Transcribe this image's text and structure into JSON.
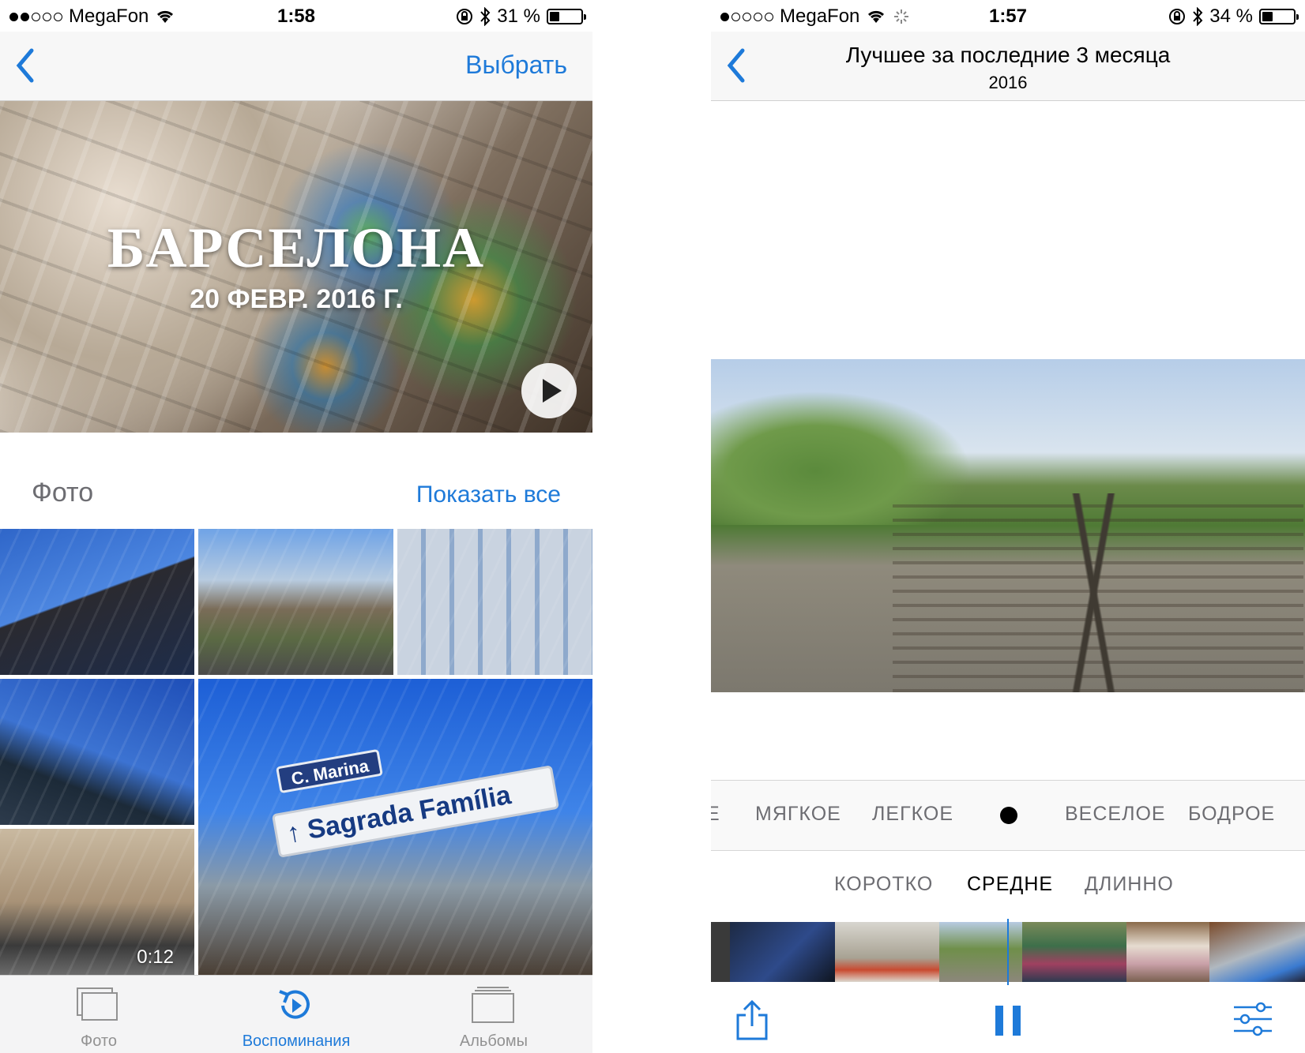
{
  "left": {
    "status": {
      "carrier": "MegaFon",
      "time": "1:58",
      "battery": "31 %",
      "battery_level": 0.31
    },
    "nav": {
      "select_label": "Выбрать"
    },
    "memory": {
      "title": "БАРСЕЛОНА",
      "date": "20 ФЕВР. 2016 Г."
    },
    "section": {
      "title": "Фото",
      "show_all": "Показать все"
    },
    "photos": [
      {
        "duration": "0:12"
      },
      {
        "sign_big": "↑ Sagrada Família",
        "sign_small": "C. Marina"
      }
    ],
    "tabs": [
      {
        "label": "Фото"
      },
      {
        "label": "Воспоминания"
      },
      {
        "label": "Альбомы"
      }
    ],
    "colors": {
      "accent": "#1e7ad9",
      "inactive": "#929292"
    }
  },
  "right": {
    "status": {
      "carrier": "MegaFon",
      "time": "1:57",
      "battery": "34 %",
      "battery_level": 0.34
    },
    "nav": {
      "title": "Лучшее за последние 3 месяца",
      "subtitle": "2016"
    },
    "moods": [
      "Е",
      "МЯГКОЕ",
      "ЛЕГКОЕ",
      "ВЕСЕЛОЕ",
      "БОДРОЕ"
    ],
    "lengths": [
      "КОРОТКО",
      "СРЕДНЕ",
      "ДЛИННО"
    ],
    "selected_length": "СРЕДНЕ"
  }
}
